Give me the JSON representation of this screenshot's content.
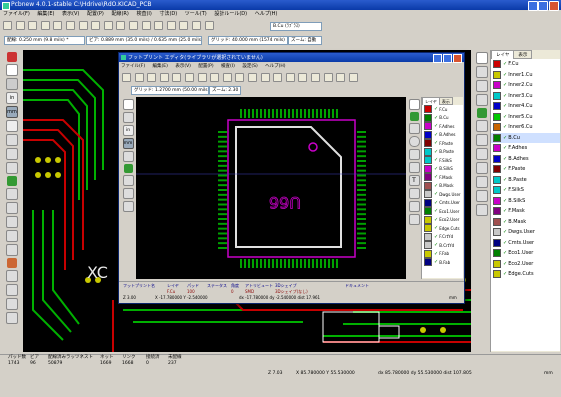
{
  "main": {
    "title": "Pcbnew 4.0.1-stable C:\\Hdrive\\RdO.KICAD_PCB",
    "menu": [
      "ファイル(F)",
      "編集(E)",
      "表示(V)",
      "配置(P)",
      "配線(R)",
      "検査(I)",
      "寸法(D)",
      "ツール(T)",
      "設計ルール(D)",
      "ヘルプ(H)"
    ],
    "layer_combo": "B.Cu (ﾗﾌﾞﾗｽ)",
    "track_combo": "配線: 0.250 mm (9.8 mils) *",
    "via_combo": "ビア: 0.889 mm (35.0 mils) / 0.635 mm (25.0 mils) *",
    "grid_combo": "グリッド: 40.000 mm (1574 mils)",
    "zoom_combo": "ズーム: 自動",
    "status": {
      "pads_label": "パッド数",
      "pads": "1743",
      "vias_label": "ビア",
      "vias": "96",
      "nodes_label": "配線済みラッツネスト",
      "nodes": "50879",
      "nets_label": "ネット",
      "nets": "1669",
      "links_label": "リンク",
      "links": "1668",
      "connected_label": "接続済",
      "connected": "0",
      "unrouted_label": "未配線",
      "unrouted": "237",
      "zoom": "Z 7.03",
      "coords": "X 85.780000  Y 55.530000",
      "delta": "dx 85.780000  dy 55.530000  dist 107.805",
      "units": "mm"
    }
  },
  "layers_panel": {
    "tabs": [
      "レイヤ",
      "表示"
    ],
    "items": [
      {
        "name": "F.Cu",
        "color": "#cc0000"
      },
      {
        "name": "Inner1.Cu",
        "color": "#c8c800"
      },
      {
        "name": "Inner2.Cu",
        "color": "#c800c8"
      },
      {
        "name": "Inner3.Cu",
        "color": "#00c8c8"
      },
      {
        "name": "Inner4.Cu",
        "color": "#0000c8"
      },
      {
        "name": "Inner5.Cu",
        "color": "#00c800"
      },
      {
        "name": "Inner6.Cu",
        "color": "#c86400"
      },
      {
        "name": "B.Cu",
        "color": "#008000"
      },
      {
        "name": "F.Adhes",
        "color": "#c800c8"
      },
      {
        "name": "B.Adhes",
        "color": "#0000c8"
      },
      {
        "name": "F.Paste",
        "color": "#800000"
      },
      {
        "name": "B.Paste",
        "color": "#00c8c8"
      },
      {
        "name": "F.SilkS",
        "color": "#00c8c8"
      },
      {
        "name": "B.SilkS",
        "color": "#c800c8"
      },
      {
        "name": "F.Mask",
        "color": "#800080"
      },
      {
        "name": "B.Mask",
        "color": "#a05050"
      },
      {
        "name": "Dwgs.User",
        "color": "#c8c8c8"
      },
      {
        "name": "Cmts.User",
        "color": "#000080"
      },
      {
        "name": "Eco1.User",
        "color": "#008000"
      },
      {
        "name": "Eco2.User",
        "color": "#c8c800"
      },
      {
        "name": "Edge.Cuts",
        "color": "#c8c800"
      }
    ]
  },
  "fp_editor": {
    "title": "フットプリント エディタ(ライブラリが選択されていません)",
    "menu": [
      "ファイル(F)",
      "編集(E)",
      "表示(V)",
      "配置(P)",
      "検査(I)",
      "設定(S)",
      "ヘルプ(H)"
    ],
    "grid_combo": "グリッド: 1.2700 mm (50.00 mils)",
    "zoom_combo": "ズーム: 2.30",
    "footprint_label": "U66",
    "status": {
      "c1_label": "フットプリント名",
      "c1": "",
      "c2_label": "レイヤ",
      "c2": "F.Cu",
      "c3_label": "パッド",
      "c3": "100",
      "c4_label": "ステータス",
      "c4": "",
      "c5_label": "角度",
      "c5": "0",
      "c6_label": "アトリビュート",
      "c6": "SMD",
      "c7_label": "3Dシェイプ",
      "c7": "3Dシェイプ(なし)",
      "c8_label": "ドキュメント",
      "c8": "キーワード",
      "zoom": "Z 3.00",
      "coords": "X -17.780000  Y -2.540000",
      "delta": "dx -17.780000  dy -2.540000  dist 17.961",
      "units": "mm"
    },
    "layers": {
      "tabs": [
        "レイヤ",
        "表示"
      ],
      "items": [
        {
          "name": "F.Cu",
          "color": "#cc0000"
        },
        {
          "name": "B.Cu",
          "color": "#008000"
        },
        {
          "name": "F.Adhes",
          "color": "#c800c8"
        },
        {
          "name": "B.Adhes",
          "color": "#0000c8"
        },
        {
          "name": "F.Paste",
          "color": "#800000"
        },
        {
          "name": "B.Paste",
          "color": "#00c8c8"
        },
        {
          "name": "F.SilkS",
          "color": "#00c8c8"
        },
        {
          "name": "B.SilkS",
          "color": "#c800c8"
        },
        {
          "name": "F.Mask",
          "color": "#800080"
        },
        {
          "name": "B.Mask",
          "color": "#a05050"
        },
        {
          "name": "Dwgs.User",
          "color": "#c8c8c8"
        },
        {
          "name": "Cmts.User",
          "color": "#000080"
        },
        {
          "name": "Eco1.User",
          "color": "#008000"
        },
        {
          "name": "Eco2.User",
          "color": "#c8c800"
        },
        {
          "name": "Edge.Cuts",
          "color": "#c8c800"
        },
        {
          "name": "F.CrtYd",
          "color": "#c8c8c8"
        },
        {
          "name": "B.CrtYd",
          "color": "#c8c8c8"
        },
        {
          "name": "F.Fab",
          "color": "#c8c800"
        },
        {
          "name": "B.Fab",
          "color": "#000080"
        }
      ]
    }
  },
  "board_text": "XC"
}
